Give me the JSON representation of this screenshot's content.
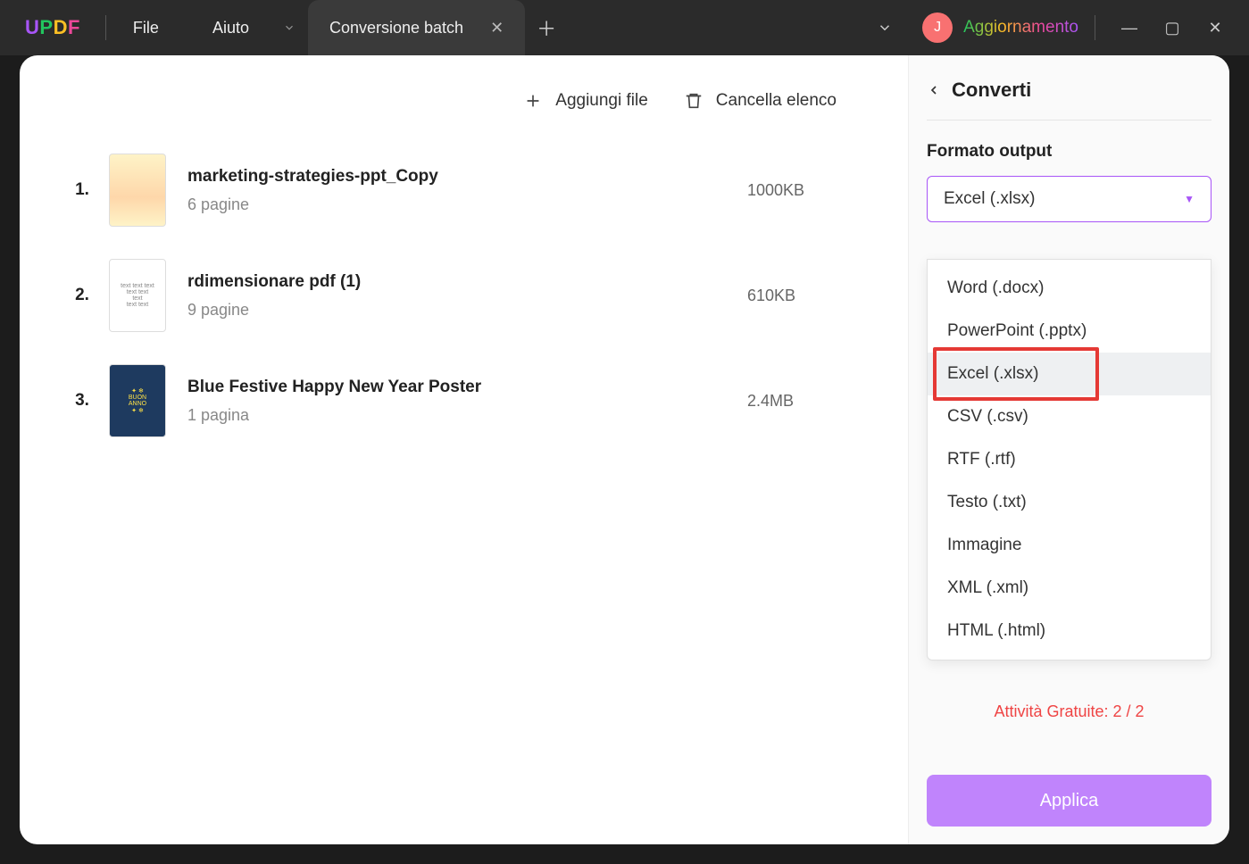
{
  "titlebar": {
    "logo_chars": [
      "U",
      "P",
      "D",
      "F"
    ],
    "menu_file": "File",
    "menu_help": "Aiuto",
    "tab_title": "Conversione batch",
    "avatar_initial": "J",
    "update_label": "Aggiornamento"
  },
  "toolbar": {
    "add_files": "Aggiungi file",
    "clear_list": "Cancella elenco"
  },
  "files": [
    {
      "num": "1.",
      "name": "marketing-strategies-ppt_Copy",
      "pages": "6 pagine",
      "size": "1000KB"
    },
    {
      "num": "2.",
      "name": "rdimensionare pdf (1)",
      "pages": "9 pagine",
      "size": "610KB"
    },
    {
      "num": "3.",
      "name": "Blue Festive Happy New Year Poster",
      "pages": "1 pagina",
      "size": "2.4MB"
    }
  ],
  "sidebar": {
    "title": "Converti",
    "format_label": "Formato output",
    "selected_format": "Excel (.xlsx)",
    "options": [
      "Word (.docx)",
      "PowerPoint (.pptx)",
      "Excel (.xlsx)",
      "CSV (.csv)",
      "RTF (.rtf)",
      "Testo (.txt)",
      "Immagine",
      "XML (.xml)",
      "HTML (.html)"
    ],
    "highlighted_index": 2,
    "free_tasks": "Attività Gratuite: 2 / 2",
    "apply": "Applica"
  }
}
